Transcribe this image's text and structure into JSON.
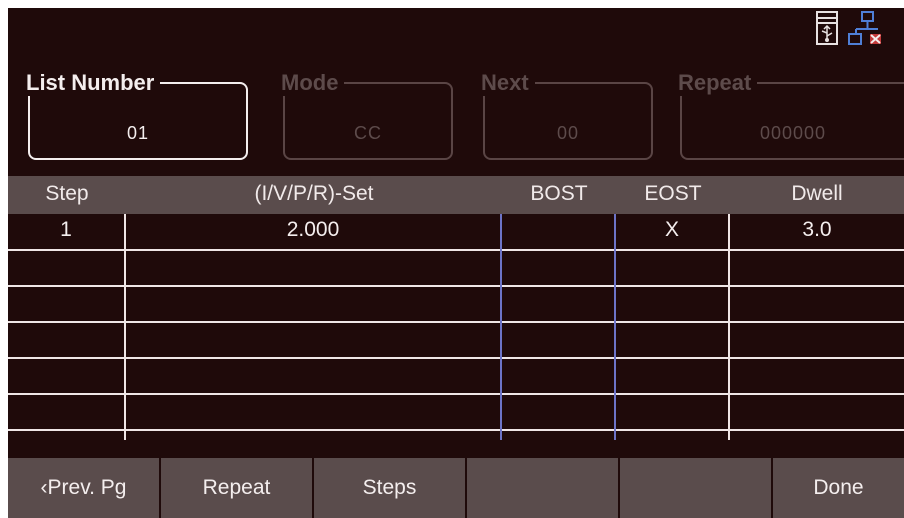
{
  "status": {
    "usb_icon": "usb-drive-icon",
    "network_icon": "network-disconnected-icon"
  },
  "params": [
    {
      "label": "List Number",
      "value": "01",
      "active": true
    },
    {
      "label": "Mode",
      "value": "CC",
      "active": false
    },
    {
      "label": "Next",
      "value": "00",
      "active": false
    },
    {
      "label": "Repeat",
      "value": "000000",
      "active": false
    }
  ],
  "table": {
    "headers": [
      "Step",
      "(I/V/P/R)-Set",
      "BOST",
      "EOST",
      "Dwell"
    ],
    "rows": [
      {
        "step": "1",
        "set": "2.000",
        "bost": "",
        "eost": "X",
        "dwell": "3.0"
      }
    ]
  },
  "softkeys": [
    "‹Prev. Pg",
    "Repeat",
    "Steps",
    "",
    "",
    "Done"
  ],
  "colors": {
    "background": "#1f0a0a",
    "header": "#5a4c4c",
    "text": "#f4eeee",
    "disabled": "#5d4b4b"
  }
}
